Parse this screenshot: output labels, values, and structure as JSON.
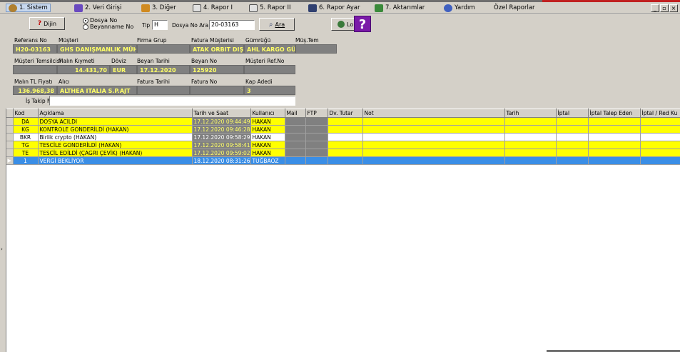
{
  "menu": {
    "items": [
      {
        "label": "1. Sistem",
        "icon": "system-icon",
        "color": "#3a6ea5"
      },
      {
        "label": "2. Veri Girişi",
        "icon": "data-entry-icon",
        "color": "#6a4ac0"
      },
      {
        "label": "3. Diğer",
        "icon": "other-icon",
        "color": "#d08a20"
      },
      {
        "label": "4. Rapor I",
        "icon": "printer-icon",
        "color": "#505050"
      },
      {
        "label": "5. Rapor II",
        "icon": "printer-icon",
        "color": "#505050"
      },
      {
        "label": "6. Rapor Ayar",
        "icon": "report-settings-icon",
        "color": "#304070"
      },
      {
        "label": "7. Aktarımlar",
        "icon": "transfer-icon",
        "color": "#3a8a3a"
      },
      {
        "label": "Yardım",
        "icon": "help-icon",
        "color": "#4060c0"
      },
      {
        "label": "Özel Raporlar",
        "icon": "",
        "color": ""
      }
    ],
    "window_buttons": {
      "minimize": "_",
      "restore": "▫",
      "close": "×"
    }
  },
  "toolbar": {
    "digin_label": "Dijin",
    "radio_dosya": "Dosya No",
    "radio_beyanname": "Beyanname No",
    "tip_label": "Tip",
    "tip_value": "H",
    "dosya_no_label": "Dosya No Ara",
    "dosya_no_value": "20-03163",
    "ara_label": "Ara",
    "log_label": "Lo"
  },
  "header": {
    "row1": {
      "labels": [
        "Referans No",
        "Müşteri",
        "Firma Grup",
        "Fatura Müşterisi",
        "Gümrüğü",
        "Müş.Tem"
      ],
      "values": [
        "H20-03163",
        "GHS DANIŞMANLIK MÜH",
        "",
        "ATAK ORBIT DIŞ",
        "AHL KARGO GÜ",
        ""
      ]
    },
    "row2": {
      "labels": [
        "Müşteri Temsilcisi",
        "Malın Kıymeti",
        "Döviz",
        "Beyan Tarihi",
        "Beyan No",
        "Müşteri Ref.No"
      ],
      "values": [
        "",
        "14.431,70",
        "EUR",
        "17.12.2020",
        "125920",
        ""
      ]
    },
    "row3": {
      "labels": [
        "Malın TL Fiyatı",
        "Alıcı",
        "Fatura Tarihi",
        "Fatura No",
        "Kap Adedi"
      ],
      "values": [
        "136.968,38",
        "ALTHEA ITALIA S.P.AJT",
        "",
        "",
        "3"
      ]
    },
    "is_takip_label": "İş Takip Not",
    "is_takip_value": ""
  },
  "grid": {
    "columns": [
      "",
      "Kod",
      "Açıklama",
      "Tarih ve Saat",
      "Kullanıcı",
      "Mail",
      "FTP",
      "Dv. Tutar",
      "Not",
      "Tarih",
      "İptal",
      "İptal Talep Eden",
      "İptal / Red Ku"
    ],
    "rows": [
      {
        "style": "yellow",
        "indicator": "",
        "kod": "DA",
        "aciklama": "DOSYA ACILDI",
        "tarih": "17.12.2020 09:44:49",
        "kullanici": "HAKAN"
      },
      {
        "style": "yellow",
        "indicator": "",
        "kod": "KG",
        "aciklama": "KONTROLE GONDERİLDİ (HAKAN)",
        "tarih": "17.12.2020 09:46:28",
        "kullanici": "HAKAN"
      },
      {
        "style": "white",
        "indicator": "",
        "kod": "BKR",
        "aciklama": "Birlik crypto (HAKAN)",
        "tarih": "17.12.2020 09:58:29",
        "kullanici": "HAKAN"
      },
      {
        "style": "yellow",
        "indicator": "",
        "kod": "TG",
        "aciklama": "TESCİLE GONDERİLDİ (HAKAN)",
        "tarih": "17.12.2020 09:58:41",
        "kullanici": "HAKAN"
      },
      {
        "style": "yellow",
        "indicator": "",
        "kod": "TE",
        "aciklama": "TESCİL EDİLDİ (ÇAGRI ÇEVİK) (HAKAN)",
        "tarih": "17.12.2020 09:59:02",
        "kullanici": "HAKAN"
      },
      {
        "style": "sel",
        "indicator": "▶",
        "kod": "1",
        "aciklama": "VERGİ BEKLİYOR",
        "tarih": "18.12.2020 08:31:26",
        "kullanici": "TUĞBAOZ"
      }
    ]
  },
  "colors": {
    "field_bg": "#808080",
    "field_text": "#ffff66",
    "row_yellow": "#ffff00",
    "row_selected": "#3a8ee6",
    "window": "#d4d0c8"
  }
}
